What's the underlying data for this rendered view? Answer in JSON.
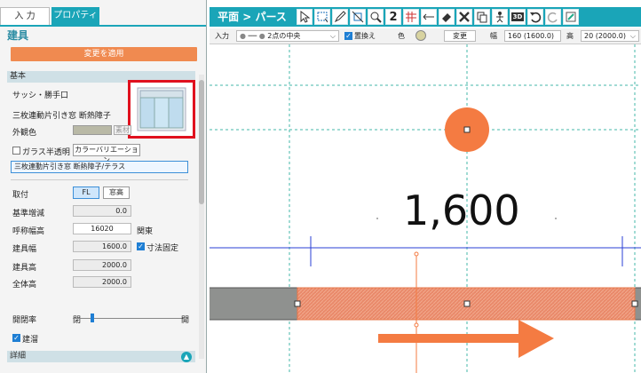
{
  "left_panel": {
    "tabs": {
      "input": "入 力",
      "properties": "プロパティ"
    },
    "title": "建具",
    "apply_button": "変更を適用",
    "section_basic": "基本",
    "type_label": "サッシ・勝手口",
    "product_name": "三枚連動片引き窓 断熱障子",
    "outer_color_label": "外観色",
    "material_button": "素材",
    "glass_label": "ガラス半透明",
    "color_variation_button": "カラーバリエーション",
    "name_value": "三枚連動片引き窓 断熱障子/テラス",
    "mount_label": "取付",
    "mount_options": [
      "FL",
      "窓高"
    ],
    "base_adjust_label": "基準増減",
    "base_adjust_value": "0.0",
    "nominal_width_label": "呼称幅高",
    "nominal_width_value": "16020",
    "nominal_unit_label": "関東",
    "fixture_width_label": "建具幅",
    "fixture_width_value": "1600.0",
    "dimension_fixed_label": "寸法固定",
    "fixture_height_label": "建具高",
    "fixture_height_value": "2000.0",
    "total_height_label": "全体高",
    "total_height_value": "2000.0",
    "opening_ratio_label": "開閉率",
    "opening_left": "閉",
    "opening_right": "開",
    "railing_label": "建溜",
    "section_detail": "詳細",
    "collapse_icon": "▲"
  },
  "toolbar": {
    "title": "平面 > パース",
    "icons": [
      "pointer-icon",
      "rect-select-icon",
      "pen-icon",
      "trim-icon",
      "zoom-icon",
      "number-two-icon",
      "grid-icon",
      "line-arrow-icon",
      "eraser-icon",
      "tools-icon",
      "copy-icon",
      "person-icon",
      "view-3d-icon",
      "undo-icon",
      "redo-icon",
      "fill-icon"
    ],
    "number_label": "2",
    "view3d_label": "3D"
  },
  "options": {
    "input_label": "入力",
    "snap_mode": "2点の中央",
    "replace_label": "置換え",
    "color_label": "色",
    "change_button": "変更",
    "width_label": "幅",
    "width_value": "160 (1600.0)",
    "height_label": "高",
    "height_value": "20 (2000.0)"
  },
  "canvas": {
    "dimension_text": "1,600"
  },
  "colors": {
    "accent": "#1aa5b8",
    "orange": "#f47b42",
    "highlight_red": "#e0101e",
    "dim_line_blue": "#2a3fd6"
  }
}
